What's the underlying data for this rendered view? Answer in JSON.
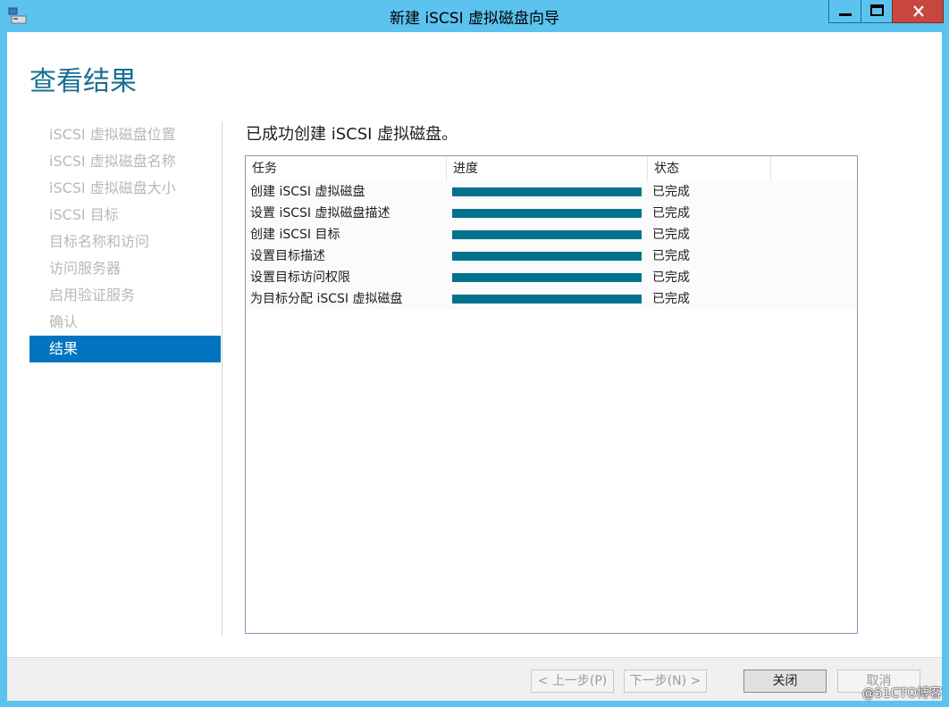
{
  "window": {
    "title": "新建 iSCSI 虚拟磁盘向导",
    "accent_color": "#5cc3ef",
    "close_color": "#c7463d"
  },
  "page": {
    "title": "查看结果",
    "success_message": "已成功创建 iSCSI 虚拟磁盘。"
  },
  "nav": {
    "items": [
      {
        "label": "iSCSI 虚拟磁盘位置"
      },
      {
        "label": "iSCSI 虚拟磁盘名称"
      },
      {
        "label": "iSCSI 虚拟磁盘大小"
      },
      {
        "label": "iSCSI 目标"
      },
      {
        "label": "目标名称和访问"
      },
      {
        "label": "访问服务器"
      },
      {
        "label": "启用验证服务"
      },
      {
        "label": "确认"
      },
      {
        "label": "结果"
      }
    ],
    "active_index": 8,
    "active_color": "#0074bf"
  },
  "table": {
    "columns": [
      "任务",
      "进度",
      "状态",
      ""
    ],
    "rows": [
      {
        "task": "创建 iSCSI 虚拟磁盘",
        "progress": 100,
        "status": "已完成"
      },
      {
        "task": "设置 iSCSI 虚拟磁盘描述",
        "progress": 100,
        "status": "已完成"
      },
      {
        "task": "创建 iSCSI 目标",
        "progress": 100,
        "status": "已完成"
      },
      {
        "task": "设置目标描述",
        "progress": 100,
        "status": "已完成"
      },
      {
        "task": "设置目标访问权限",
        "progress": 100,
        "status": "已完成"
      },
      {
        "task": "为目标分配 iSCSI 虚拟磁盘",
        "progress": 100,
        "status": "已完成"
      }
    ],
    "progress_color": "#00728e"
  },
  "footer": {
    "prev_label": "< 上一步(P)",
    "next_label": "下一步(N) >",
    "close_label": "关闭",
    "cancel_label": "取消"
  },
  "watermark": "@51CTO博客",
  "icons": {
    "app": "wizard-app-icon",
    "minimize": "minimize-icon",
    "maximize": "maximize-icon",
    "close": "close-icon"
  }
}
